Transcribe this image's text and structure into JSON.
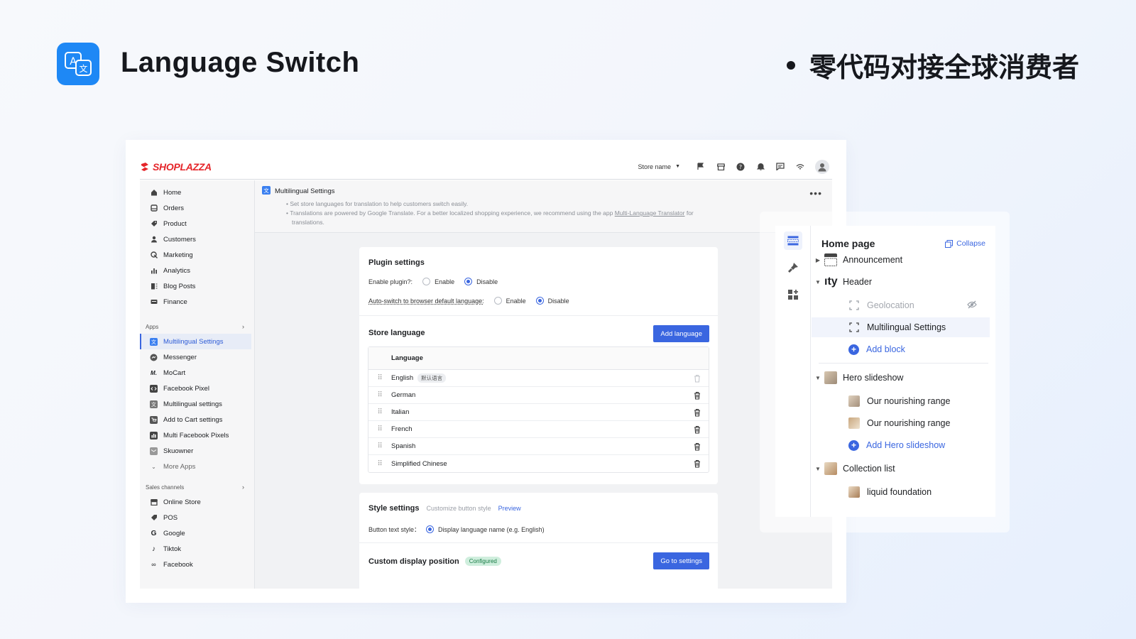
{
  "hero": {
    "title": "Language Switch",
    "tagline": "零代码对接全球消费者",
    "icon": "translate-icon",
    "accent": "#1e88f5"
  },
  "admin": {
    "brand": "SHOPLAZZA",
    "store_name": "Store name",
    "topbar_icons": [
      "flag-icon",
      "store-icon",
      "help-icon",
      "bell-icon",
      "message-icon",
      "wifi-icon",
      "user-avatar-icon"
    ],
    "sidebar": {
      "main_items": [
        {
          "label": "Home",
          "icon": "home-icon"
        },
        {
          "label": "Orders",
          "icon": "orders-icon"
        },
        {
          "label": "Product",
          "icon": "tag-icon"
        },
        {
          "label": "Customers",
          "icon": "person-icon"
        },
        {
          "label": "Marketing",
          "icon": "marketing-icon"
        },
        {
          "label": "Analytics",
          "icon": "bar-chart-icon"
        },
        {
          "label": "Blog Posts",
          "icon": "blog-icon"
        },
        {
          "label": "Finance",
          "icon": "finance-icon"
        }
      ],
      "apps_label": "Apps",
      "app_items": [
        {
          "label": "Multilingual Settings",
          "icon": "translate-icon",
          "active": true
        },
        {
          "label": "Messenger",
          "icon": "messenger-icon"
        },
        {
          "label": "MoCart",
          "icon": "mocart-icon"
        },
        {
          "label": "Facebook Pixel",
          "icon": "code-icon"
        },
        {
          "label": "Multilingual settings",
          "icon": "translate-icon"
        },
        {
          "label": "Add to Cart settings",
          "icon": "cart-icon"
        },
        {
          "label": "Multi Facebook Pixels",
          "icon": "pixels-icon"
        },
        {
          "label": "Skuowner",
          "icon": "mail-icon"
        }
      ],
      "more_apps": "More Apps",
      "sales_label": "Sales channels",
      "sales_items": [
        {
          "label": "Online Store",
          "icon": "store-icon"
        },
        {
          "label": "POS",
          "icon": "pos-icon"
        },
        {
          "label": "Google",
          "icon": "google-icon"
        },
        {
          "label": "Tiktok",
          "icon": "tiktok-icon"
        },
        {
          "label": "Facebook",
          "icon": "meta-icon"
        }
      ]
    },
    "page": {
      "title": "Multilingual Settings",
      "note_1": "Set store languages for translation to help customers switch easily.",
      "note_2a": "Translations are powered by Google Translate. For a better localized shopping experience, we recommend using the app ",
      "note_2_link": "Multi-Language Translator",
      "note_2b": " for",
      "note_3": "translations.",
      "more": "•••"
    },
    "plugin": {
      "title": "Plugin settings",
      "enable_label": "Enable plugin?:",
      "auto_label": "Auto-switch to browser default language:",
      "enable": "Enable",
      "disable": "Disable",
      "enable_value": "Disable",
      "auto_value": "Disable"
    },
    "store_language": {
      "title": "Store language",
      "add_button": "Add language",
      "column": "Language",
      "default_badge": "默认语言",
      "languages": [
        "English",
        "German",
        "Italian",
        "French",
        "Spanish",
        "Simplified Chinese"
      ]
    },
    "style": {
      "title": "Style settings",
      "hint": "Customize button style",
      "preview": "Preview",
      "button_text_label": "Button text style：",
      "button_text_value": "Display language name (e.g. English)",
      "position_title": "Custom display position",
      "position_badge": "Configured",
      "position_button": "Go to settings"
    }
  },
  "editor": {
    "title": "Home page",
    "collapse": "Collapse",
    "rail_icons": [
      "sections-icon",
      "brush-icon",
      "apps-icon"
    ],
    "announcement": "Announcement",
    "header": "Header",
    "geolocation": "Geolocation",
    "multilingual": "Multilingual Settings",
    "add_block": "Add block",
    "hero": "Hero slideshow",
    "slide_1": "Our nourishing range",
    "slide_2": "Our nourishing range",
    "add_hero": "Add Hero slideshow",
    "collection": "Collection list",
    "collection_item": "liquid foundation"
  }
}
